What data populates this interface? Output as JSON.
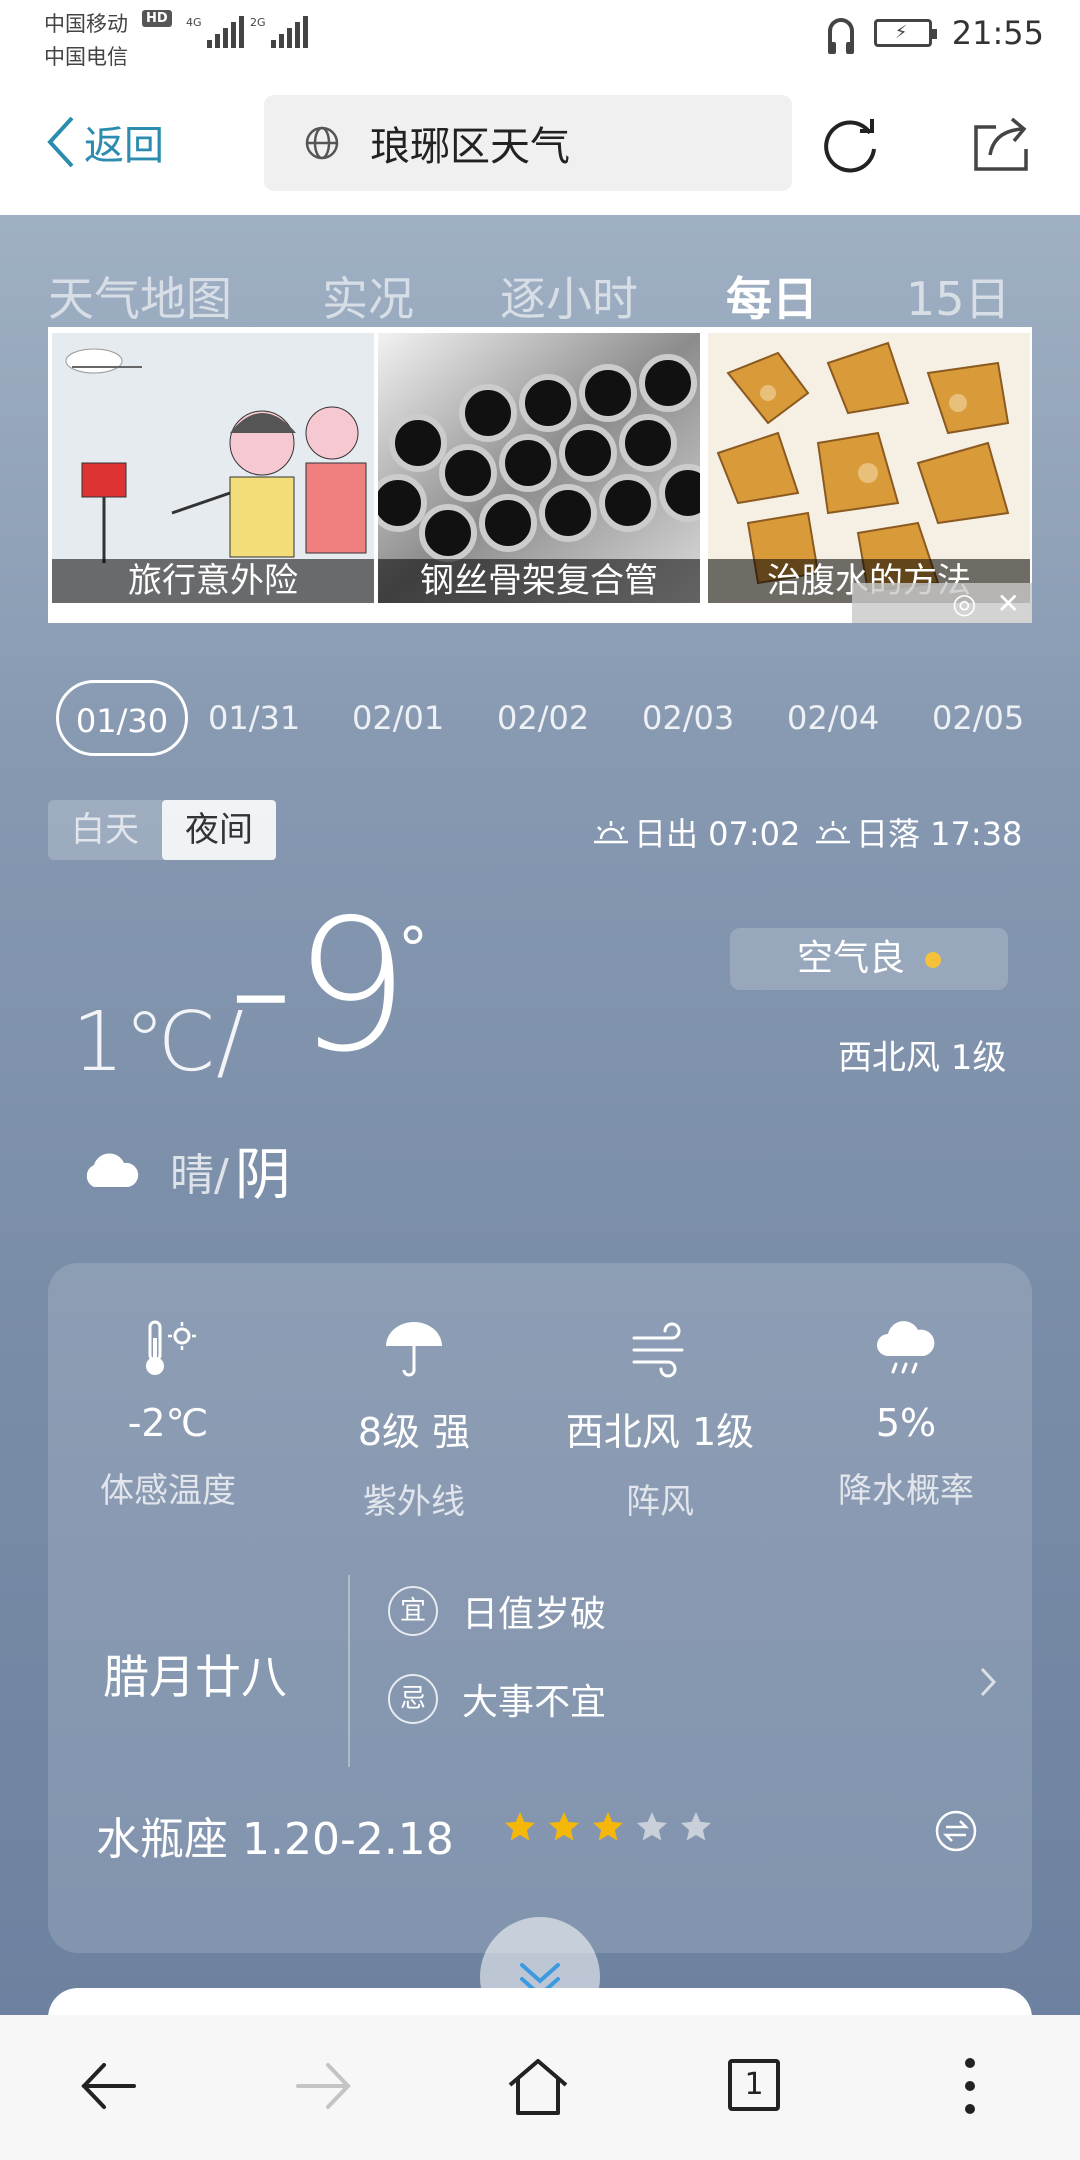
{
  "status": {
    "carrier1": "中国移动",
    "hd": "HD",
    "carrier2": "中国电信",
    "net1": "4G",
    "net2": "2G",
    "time": "21:55"
  },
  "toolbar": {
    "back_label": "返回",
    "url_text": "琅琊区天气"
  },
  "tabs": [
    "天气地图",
    "实况",
    "逐小时",
    "每日",
    "15日"
  ],
  "active_tab": "每日",
  "ad": {
    "items": [
      {
        "caption": "旅行意外险"
      },
      {
        "caption": "钢丝骨架复合管"
      },
      {
        "caption": "治腹水的方法"
      }
    ]
  },
  "dates": [
    "01/30",
    "01/31",
    "02/01",
    "02/02",
    "02/03",
    "02/04",
    "02/05"
  ],
  "selected_date": "01/30",
  "daynight": {
    "day": "白天",
    "night": "夜间",
    "selected": "夜间"
  },
  "sunrise": "日出 07:02",
  "sunset": "日落 17:38",
  "weather": {
    "temp_high": "1℃/",
    "temp_low": "-9",
    "degree": "°",
    "air_quality": "空气良",
    "wind": "西北风 1级",
    "condition_from": "晴/",
    "condition_to": "阴"
  },
  "stats": [
    {
      "value": "-2℃",
      "label": "体感温度",
      "icon": "thermometer-sun-icon"
    },
    {
      "value": "8级  强",
      "label": "紫外线",
      "icon": "umbrella-icon"
    },
    {
      "value": "西北风 1级",
      "label": "阵风",
      "icon": "wind-icon"
    },
    {
      "value": "5%",
      "label": "降水概率",
      "icon": "rain-cloud-icon"
    }
  ],
  "almanac": {
    "lunar_date": "腊月廿八",
    "yi_badge": "宜",
    "yi_text": "日值岁破",
    "ji_badge": "忌",
    "ji_text": "大事不宜"
  },
  "horoscope": {
    "sign": "水瓶座 1.20-2.18",
    "rating": 3,
    "max": 5
  },
  "colors": {
    "accent": "#2c8cb0",
    "star_on": "#f5b70a",
    "star_off": "#c9d0da",
    "air_dot": "#f5c13a"
  },
  "navbar": {
    "tab_count": "1"
  }
}
